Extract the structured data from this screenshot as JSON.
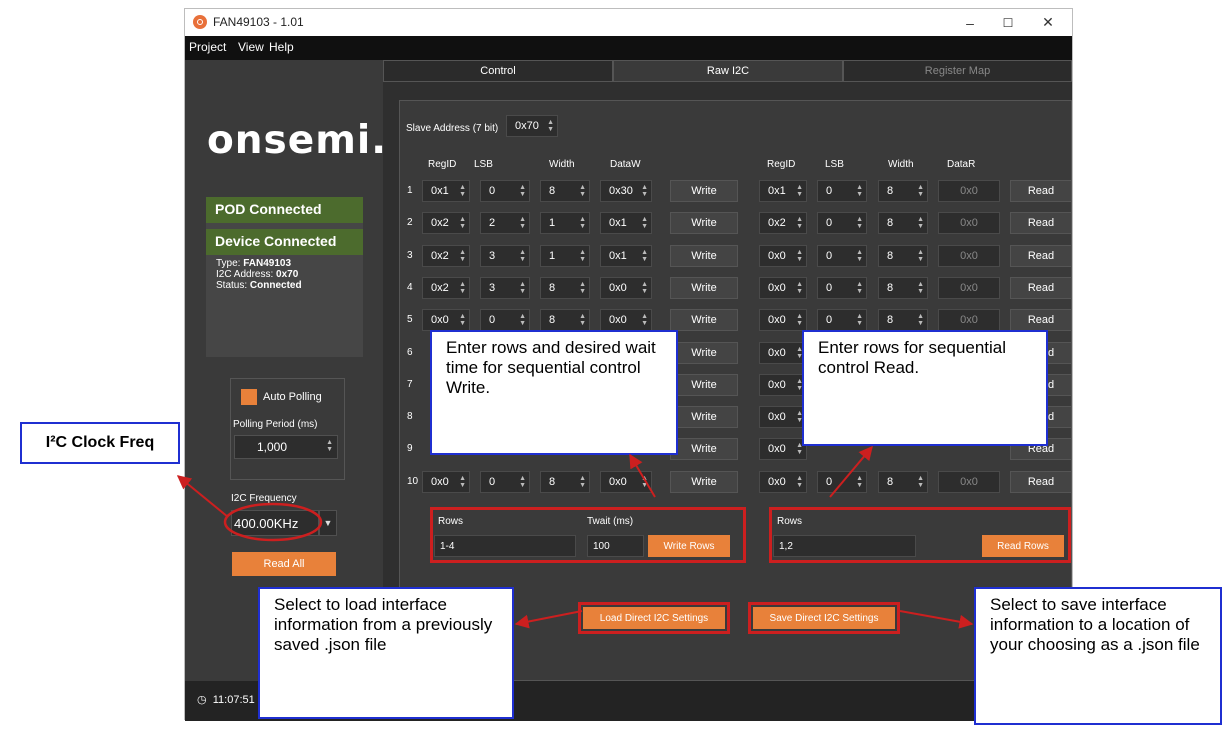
{
  "window": {
    "title": "FAN49103 - 1.01",
    "controls": [
      "–",
      "☐",
      "✕"
    ]
  },
  "menu": [
    "Project",
    "View",
    "Help"
  ],
  "tabs": [
    {
      "label": "Control"
    },
    {
      "label": "Raw I2C"
    },
    {
      "label": "Register Map"
    }
  ],
  "sidebar": {
    "logo": "onsemi.",
    "pod_status": "POD Connected",
    "device_status": "Device Connected",
    "type_label": "Type:",
    "type_value": "FAN49103",
    "address_label": "I2C Address:",
    "address_value": "0x70",
    "status_label": "Status:",
    "status_value": "Connected",
    "auto_polling": "Auto Polling",
    "polling_period_label": "Polling Period (ms)",
    "polling_period": "1,000",
    "i2c_freq_label": "I2C Frequency",
    "i2c_freq": "400.00KHz",
    "read_all": "Read All"
  },
  "status_bar": {
    "time": "11:07:51"
  },
  "raw_i2c": {
    "slave_label": "Slave Address (7 bit)",
    "slave_value": "0x70",
    "write_headers": [
      "RegID",
      "LSB",
      "Width",
      "DataW"
    ],
    "read_headers": [
      "RegID",
      "LSB",
      "Width",
      "DataR"
    ],
    "write_btn": "Write",
    "read_btn": "Read",
    "write_rows": [
      {
        "n": "1",
        "reg": "0x1",
        "lsb": "0",
        "width": "8",
        "data": "0x30"
      },
      {
        "n": "2",
        "reg": "0x2",
        "lsb": "2",
        "width": "1",
        "data": "0x1"
      },
      {
        "n": "3",
        "reg": "0x2",
        "lsb": "3",
        "width": "1",
        "data": "0x1"
      },
      {
        "n": "4",
        "reg": "0x2",
        "lsb": "3",
        "width": "8",
        "data": "0x0"
      },
      {
        "n": "5",
        "reg": "0x0",
        "lsb": "0",
        "width": "8",
        "data": "0x0"
      },
      {
        "n": "6"
      },
      {
        "n": "7"
      },
      {
        "n": "8"
      },
      {
        "n": "9"
      },
      {
        "n": "10",
        "reg": "0x0",
        "lsb": "0",
        "width": "8",
        "data": "0x0"
      }
    ],
    "read_rows": [
      {
        "reg": "0x1",
        "lsb": "0",
        "width": "8",
        "data": "0x0"
      },
      {
        "reg": "0x2",
        "lsb": "0",
        "width": "8",
        "data": "0x0"
      },
      {
        "reg": "0x0",
        "lsb": "0",
        "width": "8",
        "data": "0x0"
      },
      {
        "reg": "0x0",
        "lsb": "0",
        "width": "8",
        "data": "0x0"
      },
      {
        "reg": "0x0",
        "lsb": "0",
        "width": "8",
        "data": "0x0"
      },
      {
        "reg": "0x0"
      },
      {
        "reg": "0x0"
      },
      {
        "reg": "0x0"
      },
      {
        "reg": "0x0"
      },
      {
        "reg": "0x0",
        "lsb": "0",
        "width": "8",
        "data": "0x0"
      }
    ],
    "seq_write": {
      "rows_label": "Rows",
      "rows_value": "1-4",
      "twait_label": "Twait (ms)",
      "twait_value": "100",
      "button": "Write Rows"
    },
    "seq_read": {
      "rows_label": "Rows",
      "rows_value": "1,2",
      "button": "Read Rows"
    },
    "load_btn": "Load Direct I2C Settings",
    "save_btn": "Save Direct I2C Settings"
  },
  "annotations": {
    "freq_label": "I²C Clock Freq",
    "write_callout": "Enter rows and desired wait time for sequential control Write.",
    "read_callout": "Enter rows for sequential control Read.",
    "load_callout": "Select to load interface information from a previously saved .json file",
    "save_callout": "Select to save interface information to a location of your choosing as a .json file"
  },
  "colors": {
    "accent_orange": "#e8813a",
    "status_green": "#4c6b2d",
    "annotation_red": "#cc1f1f",
    "annotation_blue": "#1f2fd1"
  }
}
